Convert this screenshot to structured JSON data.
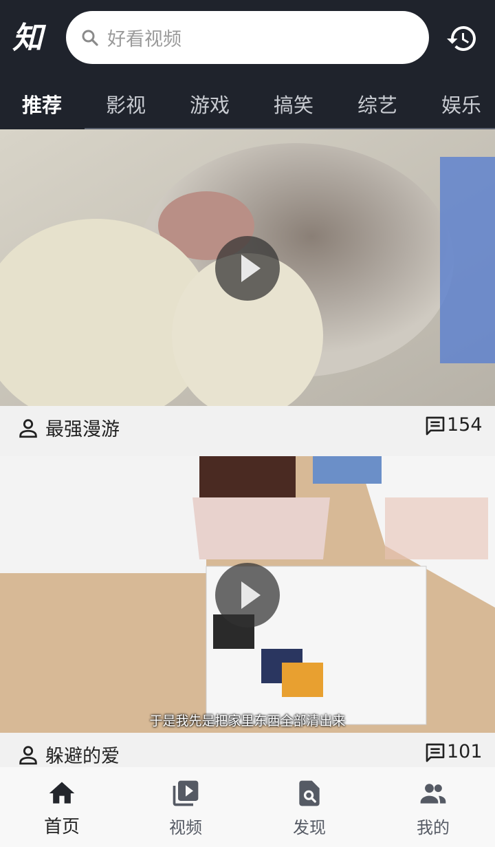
{
  "header": {
    "logo_text": "知",
    "search": {
      "placeholder": "好看视频",
      "icon": "search-icon"
    },
    "history_icon": "history-icon"
  },
  "tabs": [
    {
      "label": "推荐",
      "active": true
    },
    {
      "label": "影视"
    },
    {
      "label": "游戏"
    },
    {
      "label": "搞笑"
    },
    {
      "label": "综艺"
    },
    {
      "label": "娱乐"
    }
  ],
  "feed": [
    {
      "author": "最强漫游",
      "comments": "154",
      "subtitle": ""
    },
    {
      "author": "躲避的爱",
      "comments": "101",
      "subtitle": "于是我先是把家里东西全部清出来"
    }
  ],
  "bottom_nav": [
    {
      "label": "首页",
      "icon": "home-icon",
      "active": true
    },
    {
      "label": "视频",
      "icon": "video-library-icon"
    },
    {
      "label": "发现",
      "icon": "discover-search-icon"
    },
    {
      "label": "我的",
      "icon": "people-icon"
    }
  ],
  "colors": {
    "header_bg": "#1f232c",
    "meta_bg": "#f1f1f1",
    "nav_bg": "#f8f8f8"
  }
}
